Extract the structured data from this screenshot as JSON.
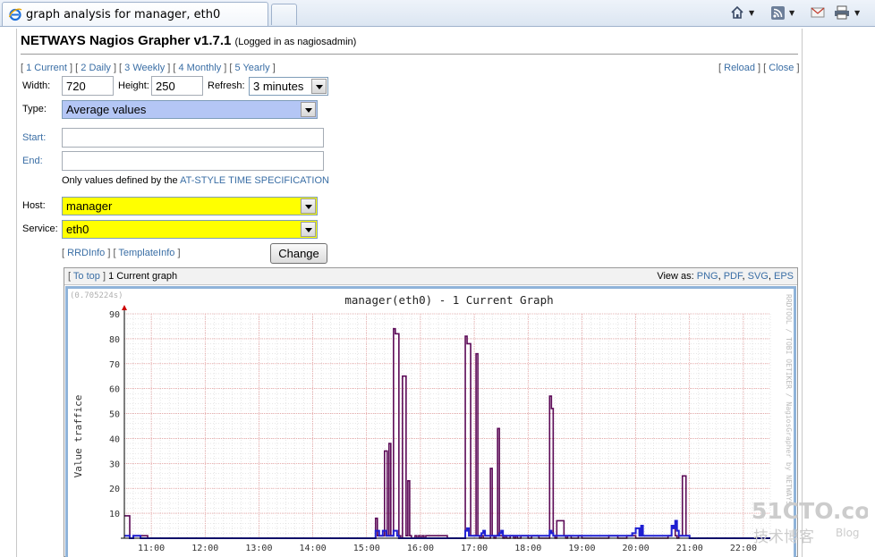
{
  "browser": {
    "tab_title": "graph analysis for manager, eth0"
  },
  "header": {
    "app_title": "NETWAYS Nagios Grapher v1.7.1",
    "login_note": "(Logged in as nagiosadmin)"
  },
  "nav": {
    "periods": [
      "1 Current",
      "2 Daily",
      "3 Weekly",
      "4 Monthly",
      "5 Yearly"
    ],
    "reload": "Reload",
    "close": "Close"
  },
  "form": {
    "width_label": "Width:",
    "width_value": "720",
    "height_label": "Height:",
    "height_value": "250",
    "refresh_label": "Refresh:",
    "refresh_value": "3 minutes",
    "type_label": "Type:",
    "type_value": "Average values",
    "start_label": "Start:",
    "end_label": "End:",
    "at_note_prefix": "Only values defined by the",
    "at_note_link": "AT-STYLE TIME SPECIFICATION",
    "host_label": "Host:",
    "host_value": "manager",
    "service_label": "Service:",
    "service_value": "eth0",
    "rrdinfo": "RRDInfo",
    "templateinfo": "TemplateInfo",
    "change_button": "Change"
  },
  "graph_panel": {
    "to_top": "To top",
    "graph_name": "1 Current graph",
    "view_as_label": "View as:",
    "formats": [
      "PNG",
      "PDF",
      "SVG",
      "EPS"
    ]
  },
  "chart_data": {
    "type": "line",
    "title": "manager(eth0) - 1 Current Graph",
    "timing_note": "(0.705224s)",
    "ylabel": "Value traffice",
    "side_text": "RRDTOOL / TOBI OETIKER  /  NagiosGrapher by NETWAYS",
    "ylim": [
      0,
      90
    ],
    "yticks": [
      10,
      20,
      30,
      40,
      50,
      60,
      70,
      80,
      90
    ],
    "xlim": [
      "10:30",
      "22:30"
    ],
    "xticks": [
      "11:00",
      "12:00",
      "13:00",
      "14:00",
      "15:00",
      "16:00",
      "17:00",
      "18:00",
      "19:00",
      "20:00",
      "21:00",
      "22:00"
    ],
    "grid": true,
    "colors": {
      "series_a": "#5c0a57",
      "series_b": "#1f1fd2",
      "grid": "#cfcfcf",
      "arrow": "#cc0000"
    },
    "series": [
      {
        "x": [
          "10:30",
          "10:36",
          "10:40",
          "10:48",
          "10:56",
          "11:00",
          "15:10",
          "15:12",
          "15:20",
          "15:23",
          "15:25",
          "15:27",
          "15:30",
          "15:32",
          "15:36",
          "15:38",
          "15:40",
          "15:44",
          "15:46",
          "15:48",
          "15:50",
          "15:54",
          "15:56",
          "15:58",
          "16:00",
          "16:02",
          "16:04",
          "16:06",
          "16:30",
          "16:48",
          "16:50",
          "16:52",
          "16:56",
          "17:02",
          "17:04",
          "17:06",
          "17:08",
          "17:10",
          "17:18",
          "17:20",
          "17:22",
          "17:24",
          "17:26",
          "17:28",
          "17:32",
          "17:34",
          "17:36",
          "17:40",
          "17:44",
          "17:46",
          "17:48",
          "17:52",
          "18:00",
          "18:04",
          "18:12",
          "18:20",
          "18:24",
          "18:26",
          "18:28",
          "18:30",
          "18:32",
          "18:40",
          "18:42",
          "18:44",
          "18:48",
          "18:56",
          "19:00",
          "19:30",
          "19:40",
          "19:50",
          "20:00",
          "20:20",
          "20:30",
          "20:36",
          "20:40",
          "20:44",
          "20:46",
          "20:48",
          "20:52",
          "20:56",
          "21:00",
          "22:30"
        ],
        "y": [
          9,
          0,
          1,
          1,
          0,
          0,
          8,
          1,
          35,
          1,
          38,
          1,
          84,
          82,
          1,
          0,
          65,
          1,
          23,
          1,
          0,
          1,
          0,
          1,
          0,
          1,
          0,
          1,
          0,
          0,
          81,
          78,
          1,
          74,
          1,
          0,
          1,
          0,
          28,
          1,
          0,
          1,
          44,
          1,
          0,
          1,
          0,
          1,
          0,
          1,
          0,
          1,
          0,
          1,
          0,
          0,
          57,
          52,
          1,
          0,
          7,
          1,
          0,
          1,
          0,
          1,
          0,
          1,
          0,
          1,
          0,
          0,
          0,
          1,
          5,
          1,
          0,
          1,
          25,
          1,
          0,
          0
        ]
      },
      {
        "x": [
          "10:30",
          "10:36",
          "10:40",
          "10:48",
          "15:10",
          "15:12",
          "15:14",
          "15:18",
          "15:22",
          "15:24",
          "15:30",
          "15:34",
          "15:36",
          "16:30",
          "16:50",
          "16:52",
          "16:54",
          "17:08",
          "17:10",
          "17:12",
          "17:28",
          "17:30",
          "17:32",
          "18:24",
          "18:26",
          "18:28",
          "19:56",
          "20:00",
          "20:04",
          "20:06",
          "20:08",
          "20:36",
          "20:40",
          "20:42",
          "20:44",
          "20:46",
          "20:48",
          "21:00",
          "22:30"
        ],
        "y": [
          1,
          0,
          1,
          0,
          3,
          3,
          1,
          3,
          1,
          1,
          3,
          1,
          0,
          0,
          3,
          4,
          1,
          2,
          3,
          1,
          2,
          3,
          1,
          3,
          2,
          1,
          2,
          4,
          1,
          5,
          1,
          1,
          5,
          4,
          7,
          3,
          1,
          0,
          0
        ]
      }
    ]
  }
}
